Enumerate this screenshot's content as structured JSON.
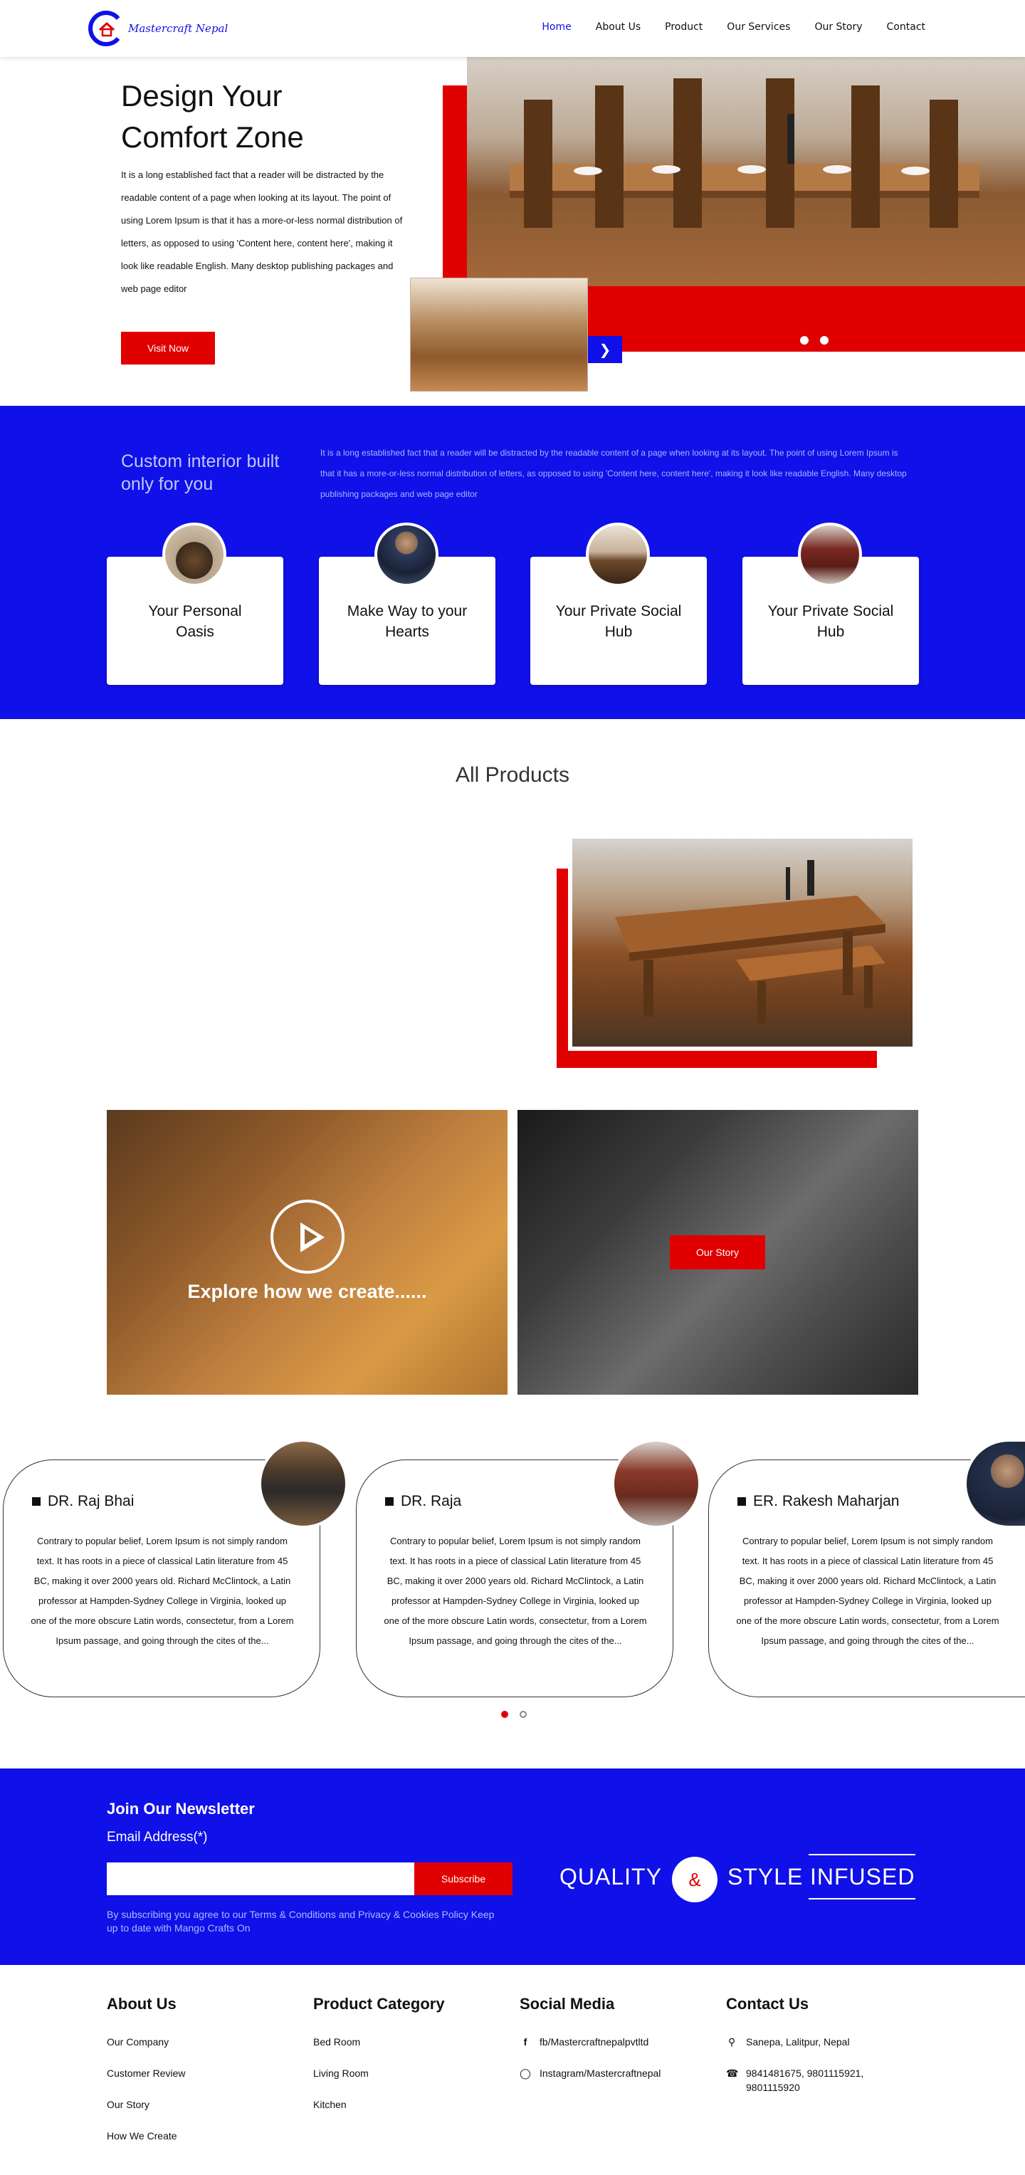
{
  "header": {
    "logo_text": "Mastercraft Nepal",
    "nav": [
      {
        "label": "Home",
        "active": true
      },
      {
        "label": "About Us"
      },
      {
        "label": "Product"
      },
      {
        "label": "Our Services"
      },
      {
        "label": "Our Story"
      },
      {
        "label": "Contact"
      }
    ]
  },
  "hero": {
    "title_line1": "Design Your",
    "title_line2": "Comfort Zone",
    "text": "It is a long established fact that a reader will be distracted by the readable content of a page when looking at its layout. The point of using Lorem Ipsum is that it has a more-or-less normal distribution of letters, as opposed to using 'Content here, content here', making it look like readable English. Many desktop publishing packages and web page editor",
    "button": "Visit Now",
    "next_icon": "chevron-right-icon"
  },
  "features": {
    "title": "Custom interior built only for you",
    "text": "It is a long established fact that a reader will be distracted by the readable content of a page when looking at its layout. The point of using Lorem Ipsum is that it has a more-or-less normal distribution of letters, as opposed to using 'Content here, content here', making it look like readable English. Many desktop publishing packages and web page editor",
    "cards": [
      {
        "title": "Your Personal Oasis"
      },
      {
        "title": "Make Way to your Hearts"
      },
      {
        "title": "Your Private Social Hub"
      },
      {
        "title": "Your Private Social Hub"
      }
    ]
  },
  "products": {
    "title": "All Products"
  },
  "video": {
    "caption": "Explore how we create......",
    "story_button": "Our Story"
  },
  "testimonials": [
    {
      "name": "DR. Raj Bhai",
      "text": "Contrary to popular belief, Lorem Ipsum is not simply random text. It has roots in a piece of classical Latin literature from 45 BC, making it over 2000 years old. Richard McClintock, a Latin professor at Hampden-Sydney College in Virginia, looked up one of the more obscure Latin words, consectetur, from a Lorem Ipsum passage, and going through the cites of the..."
    },
    {
      "name": "DR. Raja",
      "text": "Contrary to popular belief, Lorem Ipsum is not simply random text. It has roots in a piece of classical Latin literature from 45 BC, making it over 2000 years old. Richard McClintock, a Latin professor at Hampden-Sydney College in Virginia, looked up one of the more obscure Latin words, consectetur, from a Lorem Ipsum passage, and going through the cites of the..."
    },
    {
      "name": "ER. Rakesh Maharjan",
      "text": "Contrary to popular belief, Lorem Ipsum is not simply random text. It has roots in a piece of classical Latin literature from 45 BC, making it over 2000 years old. Richard McClintock, a Latin professor at Hampden-Sydney College in Virginia, looked up one of the more obscure Latin words, consectetur, from a Lorem Ipsum passage, and going through the cites of the..."
    }
  ],
  "newsletter": {
    "title": "Join Our Newsletter",
    "label": "Email Address(*)",
    "placeholder": "",
    "button": "Subscribe",
    "note": "By subscribing you agree to our Terms & Conditions and Privacy & Cookies Policy Keep up to date with Mango Crafts On",
    "tagline_quality": "QUALITY",
    "tagline_amp": "&",
    "tagline_style": "STYLE",
    "tagline_infused": "INFUSED"
  },
  "footer": {
    "about": {
      "title": "About Us",
      "links": [
        "Our Company",
        "Customer Review",
        "Our Story",
        "How We Create"
      ]
    },
    "category": {
      "title": "Product Category",
      "links": [
        "Bed Room",
        "Living Room",
        "Kitchen"
      ]
    },
    "social": {
      "title": "Social Media",
      "facebook": "fb/Mastercraftnepalpvtltd",
      "instagram": "Instagram/Mastercraftnepal"
    },
    "contact": {
      "title": "Contact Us",
      "address": "Sanepa, Lalitpur, Nepal",
      "phone": "9841481675, 9801115921, 9801115920"
    }
  },
  "colors": {
    "brand_blue": "#1010e8",
    "accent_red": "#e00000"
  }
}
